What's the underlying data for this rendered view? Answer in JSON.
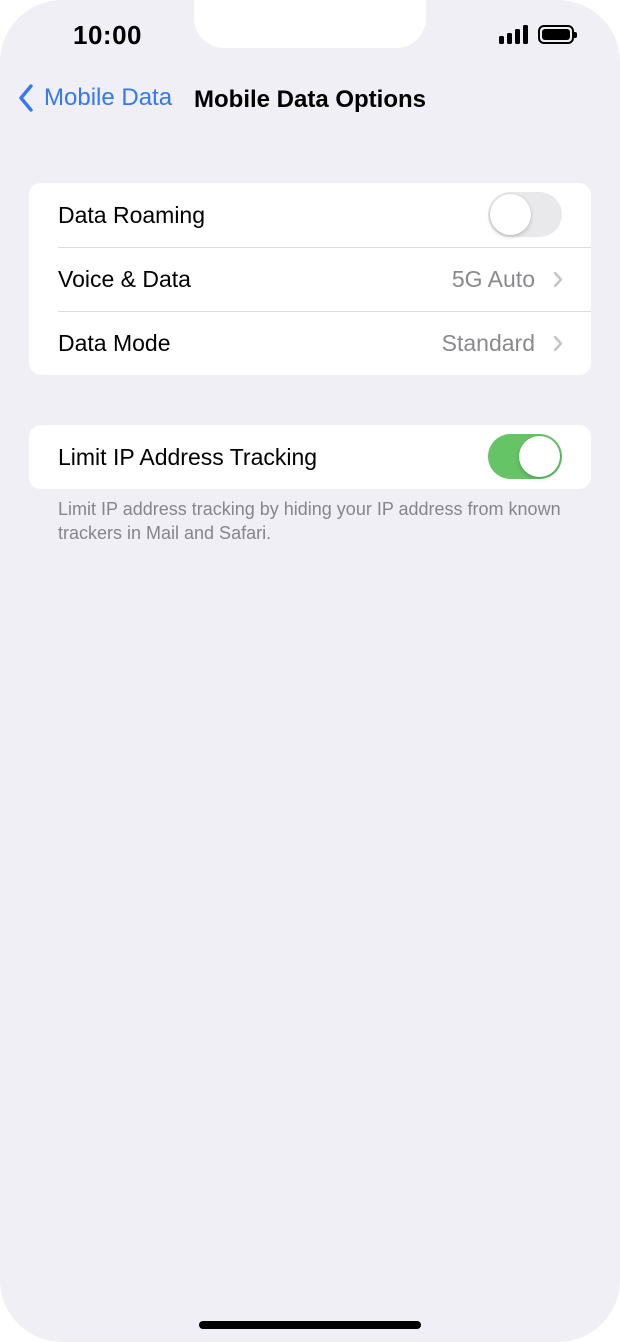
{
  "status_bar": {
    "time": "10:00",
    "signal_icon": "cellular-signal-icon",
    "battery_icon": "battery-icon",
    "battery_level": 1.0
  },
  "nav": {
    "back_label": "Mobile Data",
    "back_icon": "chevron-left-icon",
    "title": "Mobile Data Options"
  },
  "settings_group": {
    "rows": [
      {
        "label": "Data Roaming",
        "control": "toggle",
        "on": false
      },
      {
        "label": "Voice & Data",
        "value": "5G Auto",
        "control": "disclosure"
      },
      {
        "label": "Data Mode",
        "value": "Standard",
        "control": "disclosure"
      }
    ]
  },
  "privacy_group": {
    "rows": [
      {
        "label": "Limit IP Address Tracking",
        "control": "toggle",
        "on": true
      }
    ],
    "footnote": "Limit IP address tracking by hiding your IP address from known trackers in Mail and Safari."
  },
  "colors": {
    "accent": "#3478f6",
    "toggle_on": "#65c466",
    "toggle_off": "#e9e9eb",
    "background": "#f0eff5"
  }
}
